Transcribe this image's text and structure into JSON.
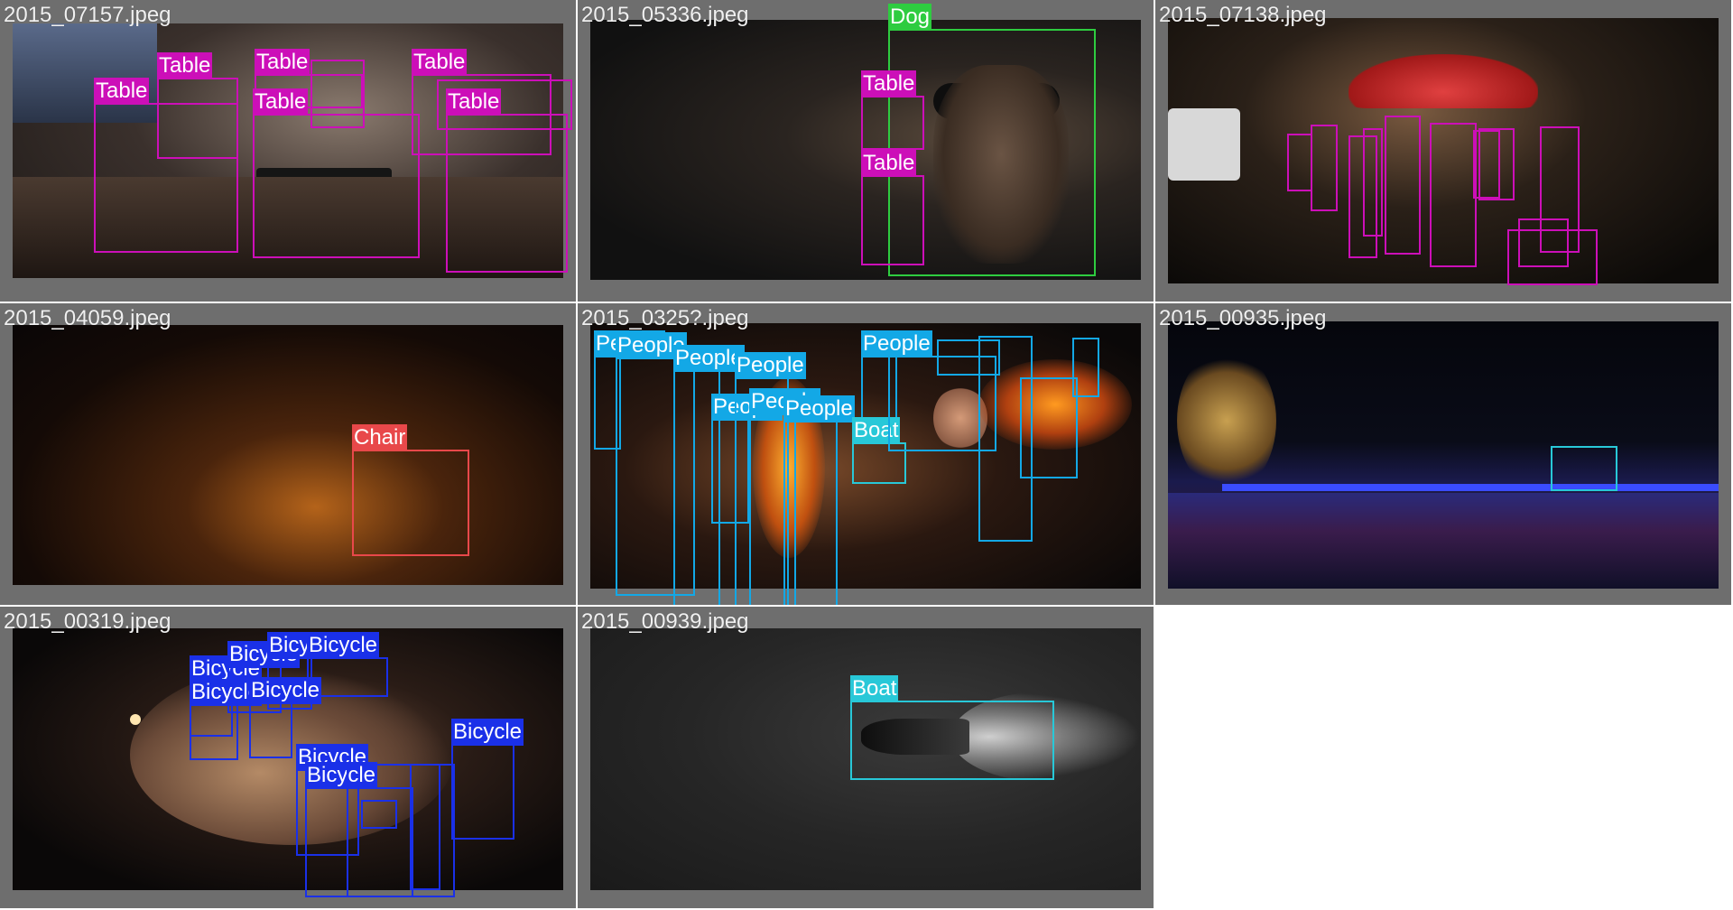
{
  "colors": {
    "tile_bg": "#6e6e6e",
    "page_bg": "#ffffff",
    "classes": {
      "Table": "#cc0fb8",
      "Dog": "#2ecc40",
      "Chair": "#e8484a",
      "People": "#13a8e6",
      "Boat": "#28c8d8",
      "Bicycle": "#1a30e8"
    }
  },
  "tiles": [
    {
      "filename": "2015_07157.jpeg",
      "photo_tone": "indoor-room",
      "boxes": [
        {
          "label": "Table"
        },
        {
          "label": "Table"
        },
        {
          "label": "Table"
        },
        {
          "label": "Table"
        },
        {
          "label": "Table"
        },
        {
          "label": "Table"
        },
        {
          "label": ""
        },
        {
          "label": ""
        }
      ]
    },
    {
      "filename": "2015_05336.jpeg",
      "photo_tone": "dark-dog",
      "boxes": [
        {
          "label": "Dog"
        },
        {
          "label": "Table"
        },
        {
          "label": "Table"
        }
      ]
    },
    {
      "filename": "2015_07138.jpeg",
      "photo_tone": "night-street",
      "boxes": [
        {
          "label": ""
        },
        {
          "label": ""
        },
        {
          "label": ""
        },
        {
          "label": ""
        },
        {
          "label": ""
        },
        {
          "label": ""
        },
        {
          "label": ""
        },
        {
          "label": ""
        },
        {
          "label": ""
        },
        {
          "label": ""
        },
        {
          "label": ""
        }
      ]
    },
    {
      "filename": "2015_04059.jpeg",
      "photo_tone": "night-snow",
      "boxes": [
        {
          "label": "Chair"
        }
      ]
    },
    {
      "filename": "2015_0325?.jpeg",
      "photo_tone": "fire-party",
      "boxes": [
        {
          "label": "People"
        },
        {
          "label": "People"
        },
        {
          "label": "People"
        },
        {
          "label": "People"
        },
        {
          "label": "People"
        },
        {
          "label": "People"
        },
        {
          "label": "People"
        },
        {
          "label": "People"
        },
        {
          "label": "Boat"
        },
        {
          "label": ""
        },
        {
          "label": ""
        },
        {
          "label": ""
        },
        {
          "label": ""
        },
        {
          "label": ""
        },
        {
          "label": ""
        }
      ]
    },
    {
      "filename": "2015_00935.jpeg",
      "photo_tone": "night-river",
      "boxes": [
        {
          "label": ""
        }
      ]
    },
    {
      "filename": "2015_00319.jpeg",
      "photo_tone": "night-sculpture",
      "boxes": [
        {
          "label": "Bicycle"
        },
        {
          "label": "Bicycle"
        },
        {
          "label": "Bicycle"
        },
        {
          "label": "Bicycle"
        },
        {
          "label": "Bicycle"
        },
        {
          "label": "Bicycle"
        },
        {
          "label": "Bicycle"
        },
        {
          "label": "Bicycle"
        },
        {
          "label": "Bicycle"
        },
        {
          "label": ""
        },
        {
          "label": ""
        },
        {
          "label": ""
        }
      ]
    },
    {
      "filename": "2015_00939.jpeg",
      "photo_tone": "water-boat",
      "boxes": [
        {
          "label": "Boat"
        }
      ]
    }
  ]
}
